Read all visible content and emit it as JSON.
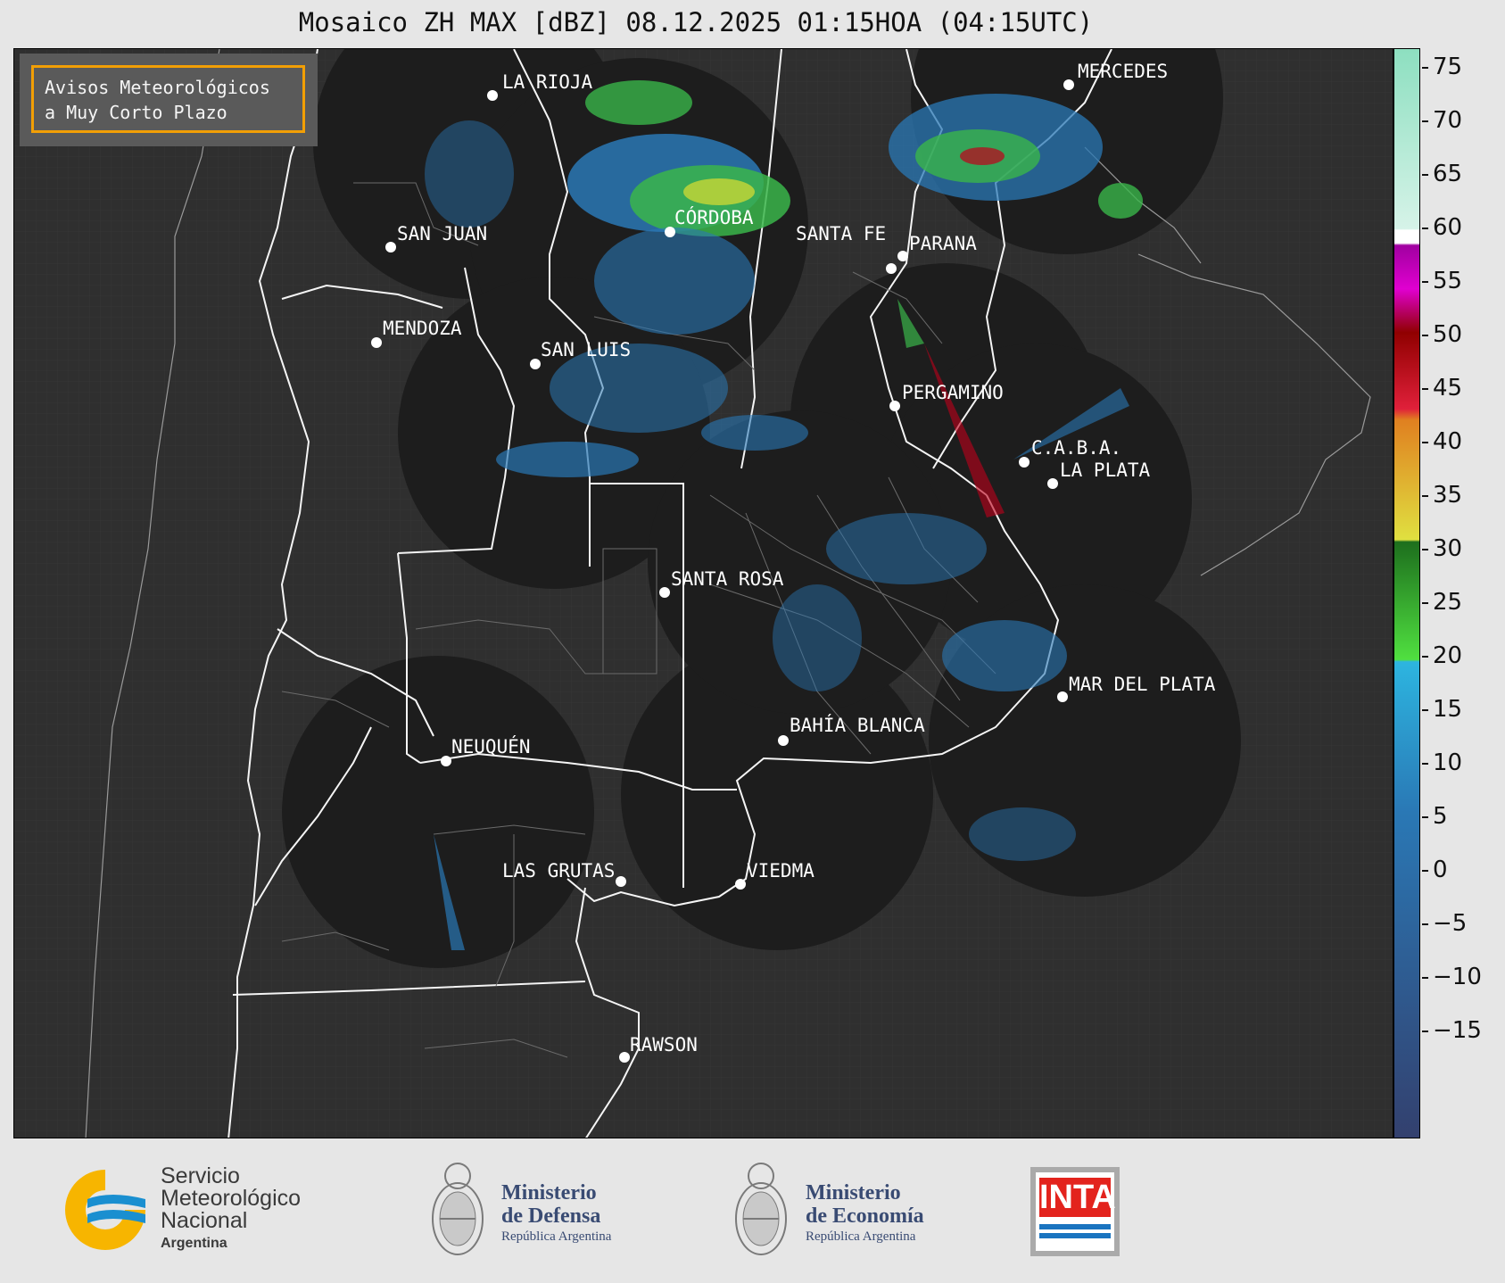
{
  "title": "Mosaico ZH MAX [dBZ] 08.12.2025 01:15HOA (04:15UTC)",
  "notice": {
    "line1": "Avisos Meteorológicos",
    "line2": "a Muy Corto Plazo"
  },
  "cities": [
    {
      "name": "LA RIOJA"
    },
    {
      "name": "MERCEDES"
    },
    {
      "name": "CÓRDOBA"
    },
    {
      "name": "SAN JUAN"
    },
    {
      "name": "SANTA FE"
    },
    {
      "name": "PARANA"
    },
    {
      "name": "MENDOZA"
    },
    {
      "name": "SAN LUIS"
    },
    {
      "name": "PERGAMINO"
    },
    {
      "name": "C.A.B.A."
    },
    {
      "name": "LA PLATA"
    },
    {
      "name": "SANTA ROSA"
    },
    {
      "name": "MAR DEL PLATA"
    },
    {
      "name": "BAHÍA BLANCA"
    },
    {
      "name": "NEUQUÉN"
    },
    {
      "name": "LAS GRUTAS"
    },
    {
      "name": "VIEDMA"
    },
    {
      "name": "RAWSON"
    }
  ],
  "colorbar": {
    "ticks": [
      "75",
      "70",
      "65",
      "60",
      "55",
      "50",
      "45",
      "40",
      "35",
      "30",
      "25",
      "20",
      "15",
      "10",
      "5",
      "0",
      "−5",
      "−10",
      "−15"
    ],
    "colors": {
      "high": "#8ddfc0",
      "white": "#ffffff",
      "purple": "#a000a0",
      "magenta": "#e000d0",
      "red": "#c0001a",
      "orange": "#e08020",
      "yellow": "#dddd30",
      "green_dark": "#1d6e1d",
      "green_light": "#50e040",
      "cyan": "#2db5e0",
      "blue": "#2a78b5",
      "navy": "#33406e"
    }
  },
  "logos": {
    "smn": {
      "line1": "Servicio",
      "line2": "Meteorológico",
      "line3": "Nacional",
      "line4": "Argentina"
    },
    "defensa": {
      "line1": "Ministerio",
      "line2": "de Defensa",
      "line3": "República Argentina"
    },
    "economia": {
      "line1": "Ministerio",
      "line2": "de Economía",
      "line3": "República Argentina"
    },
    "inta": {
      "text": "INTA"
    }
  }
}
